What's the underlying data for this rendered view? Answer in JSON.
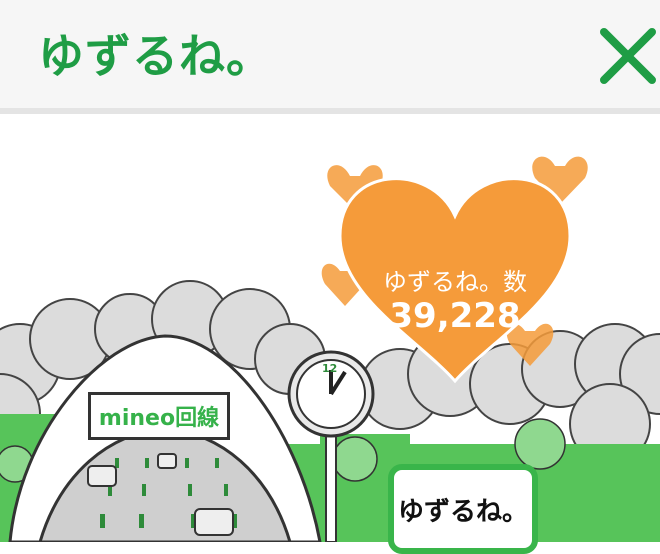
{
  "header": {
    "title": "ゆずるね。",
    "close_icon": "close-x-icon",
    "accent_color": "#1f9d45"
  },
  "counter": {
    "label": "ゆずるね。数",
    "value": "39,228",
    "heart_color": "#f59b3a"
  },
  "illustration": {
    "sign_text": "mineo回線",
    "clock_number": "12",
    "badge_text": "ゆずるね。"
  }
}
